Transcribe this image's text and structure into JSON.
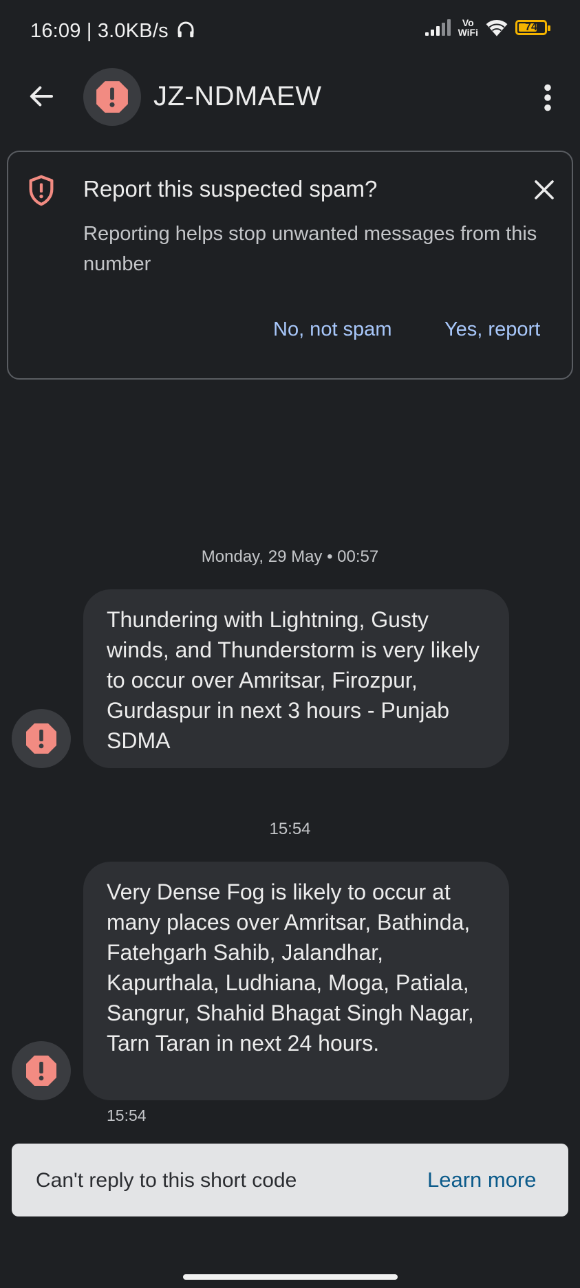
{
  "status_bar": {
    "time": "16:09",
    "speed": "3.0KB/s",
    "network_label_top": "Vo",
    "network_label_bottom": "WiFi",
    "battery": "74",
    "battery_level": 0.74
  },
  "header": {
    "title": "JZ-NDMAEW",
    "icons": {
      "back": "arrow-left-icon",
      "avatar": "alert-octagon-icon",
      "menu": "more-vertical-icon"
    }
  },
  "spam_card": {
    "title": "Report this suspected spam?",
    "description": "Reporting helps stop unwanted messages from this number",
    "no_label": "No, not spam",
    "yes_label": "Yes, report",
    "icons": {
      "shield": "shield-alert-icon",
      "close": "close-icon"
    }
  },
  "messages": [
    {
      "date_label": "Monday, 29 May • 00:57",
      "text": "Thundering with Lightning, Gusty winds, and Thunderstorm is very likely to occur over Amritsar, Firozpur, Gurdaspur in next 3 hours - Punjab SDMA"
    },
    {
      "date_label": "15:54",
      "text": "Very Dense Fog is likely to occur at many places over Amritsar, Bathinda, Fatehgarh Sahib, Jalandhar, Kapurthala, Ludhiana, Moga, Patiala, Sangrur, Shahid Bhagat Singh Nagar, Tarn Taran in next 24 hours.",
      "time": "15:54"
    }
  ],
  "reply_bar": {
    "text": "Can't reply to this short code",
    "link": "Learn more"
  },
  "colors": {
    "background": "#1e2023",
    "bubble": "#2e3034",
    "accent_link": "#a8c7fa",
    "alert_red": "#f28b82",
    "battery": "#f5b400"
  }
}
